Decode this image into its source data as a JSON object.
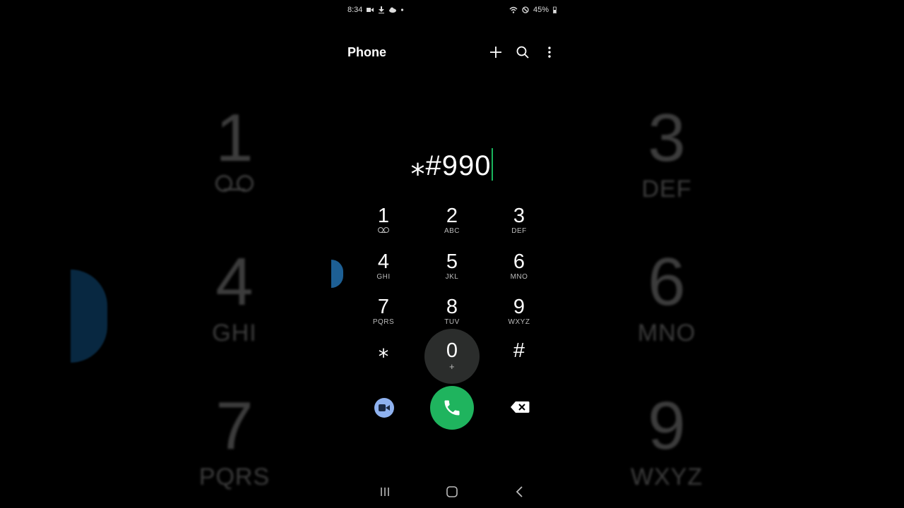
{
  "status_bar": {
    "time": "8:34",
    "battery": "45%"
  },
  "app_bar": {
    "title": "Phone"
  },
  "dialer": {
    "entered_number": "⁎#990"
  },
  "keypad": [
    {
      "digit": "1",
      "letters": ""
    },
    {
      "digit": "2",
      "letters": "ABC"
    },
    {
      "digit": "3",
      "letters": "DEF"
    },
    {
      "digit": "4",
      "letters": "GHI"
    },
    {
      "digit": "5",
      "letters": "JKL"
    },
    {
      "digit": "6",
      "letters": "MNO"
    },
    {
      "digit": "7",
      "letters": "PQRS"
    },
    {
      "digit": "8",
      "letters": "TUV"
    },
    {
      "digit": "9",
      "letters": "WXYZ"
    },
    {
      "digit": "⁎",
      "letters": ""
    },
    {
      "digit": "0",
      "letters": "+"
    },
    {
      "digit": "#",
      "letters": ""
    }
  ],
  "background_keys": [
    {
      "digit": "1",
      "letters": ""
    },
    {
      "digit": "3",
      "letters": "DEF"
    },
    {
      "digit": "4",
      "letters": "GHI"
    },
    {
      "digit": "6",
      "letters": "MNO"
    },
    {
      "digit": "7",
      "letters": "PQRS"
    },
    {
      "digit": "9",
      "letters": "WXYZ"
    }
  ],
  "icons": {
    "add": "plus-icon",
    "search": "search-icon",
    "more": "more-vert-icon",
    "voicemail": "voicemail-icon",
    "video_call": "video-camera-icon",
    "call": "phone-handset-icon",
    "backspace": "backspace-icon",
    "nav_recents": "recent-apps-icon",
    "nav_home": "home-icon",
    "nav_back": "back-icon"
  },
  "colors": {
    "background": "#000000",
    "call_button": "#1fb45e",
    "cursor": "#19b45c",
    "video_button": "#8fb2f0",
    "zero_key_pressed": "#2b2d2c"
  }
}
